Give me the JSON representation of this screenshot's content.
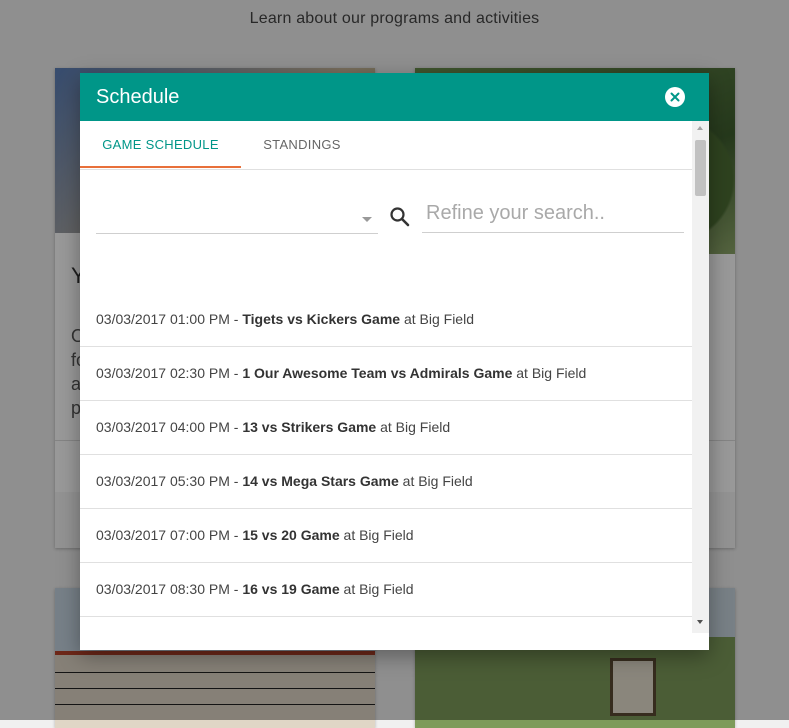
{
  "page": {
    "heading": "Learn about our programs and activities"
  },
  "cards": {
    "left_title_initial": "Y",
    "left_body_initials": [
      "O",
      "fo",
      "a",
      "p"
    ]
  },
  "modal": {
    "title": "Schedule",
    "close_icon": "close-circle-icon",
    "tabs": [
      {
        "label": "GAME SCHEDULE",
        "active": true
      },
      {
        "label": "STANDINGS",
        "active": false
      }
    ],
    "filter": {
      "selected": ""
    },
    "search": {
      "placeholder": "Refine your search.."
    },
    "games": [
      {
        "datetime": "03/03/2017 01:00 PM",
        "sep": " - ",
        "name": "Tigets vs Kickers Game",
        "location": " at Big Field"
      },
      {
        "datetime": "03/03/2017 02:30 PM",
        "sep": " - ",
        "name": "1 Our Awesome Team vs Admirals Game",
        "location": " at Big Field"
      },
      {
        "datetime": "03/03/2017 04:00 PM",
        "sep": " - ",
        "name": "13 vs Strikers Game",
        "location": " at Big Field"
      },
      {
        "datetime": "03/03/2017 05:30 PM",
        "sep": " - ",
        "name": "14 vs Mega Stars Game",
        "location": " at Big Field"
      },
      {
        "datetime": "03/03/2017 07:00 PM",
        "sep": " - ",
        "name": "15 vs 20 Game",
        "location": " at Big Field"
      },
      {
        "datetime": "03/03/2017 08:30 PM",
        "sep": " - ",
        "name": "16 vs 19 Game",
        "location": " at Big Field"
      }
    ]
  },
  "colors": {
    "header": "#009688",
    "tab_active": "#009688",
    "tab_indicator": "#e8703a"
  }
}
